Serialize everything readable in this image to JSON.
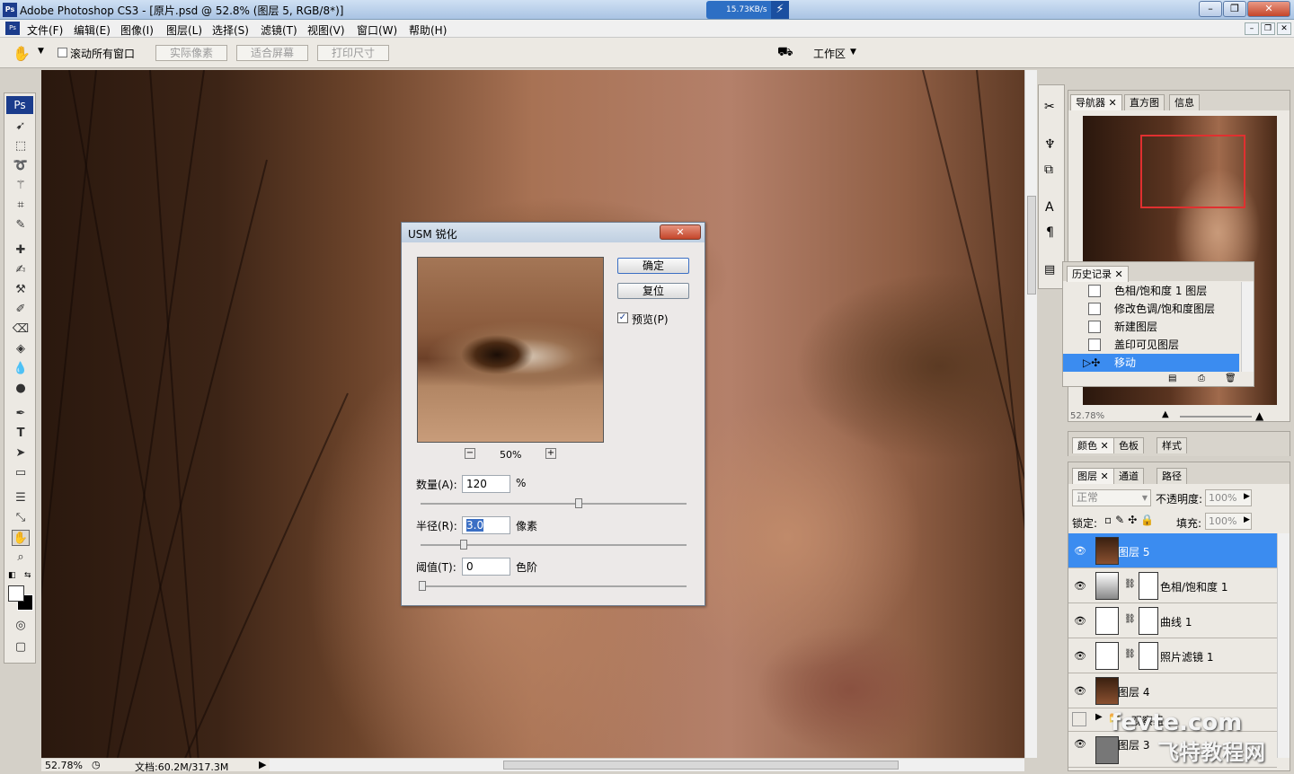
{
  "window": {
    "title": "Adobe Photoshop CS3 - [原片.psd @ 52.8% (图层 5, RGB/8*)]",
    "app_icon": "Ps"
  },
  "net_speed": {
    "value": "15.73KB/s"
  },
  "menu": [
    "文件(F)",
    "编辑(E)",
    "图像(I)",
    "图层(L)",
    "选择(S)",
    "滤镜(T)",
    "视图(V)",
    "窗口(W)",
    "帮助(H)"
  ],
  "options": {
    "scroll_all": "滚动所有窗口",
    "actual_pixels": "实际像素",
    "fit_screen": "适合屏幕",
    "print_size": "打印尺寸",
    "workspace": "工作区"
  },
  "status": {
    "zoom": "52.78%",
    "doc": "文档:60.2M/317.3M"
  },
  "dialog": {
    "title": "USM 锐化",
    "ok": "确定",
    "reset": "复位",
    "preview_label": "预览(P)",
    "preview_checked": true,
    "zoom": "50%",
    "amount_label": "数量(A):",
    "amount": "120",
    "amount_unit": "%",
    "radius_label": "半径(R):",
    "radius": "3.0",
    "radius_unit": "像素",
    "threshold_label": "阈值(T):",
    "threshold": "0",
    "threshold_unit": "色阶"
  },
  "navigator": {
    "tabs": [
      "导航器",
      "直方图",
      "信息"
    ],
    "zoom": "52.78%"
  },
  "history": {
    "tab": "历史记录",
    "items": [
      "色相/饱和度 1 图层",
      "修改色调/饱和度图层",
      "新建图层",
      "盖印可见图层",
      "移动"
    ]
  },
  "color_panel": {
    "tabs": [
      "颜色",
      "色板",
      "样式"
    ]
  },
  "layers": {
    "tabs": [
      "图层",
      "通道",
      "路径"
    ],
    "blend_mode": "正常",
    "opacity_label": "不透明度:",
    "opacity": "100%",
    "lock_label": "锁定:",
    "fill_label": "填充:",
    "fill": "100%",
    "items": [
      "图层 5",
      "色相/饱和度 1",
      "曲线 1",
      "照片滤镜 1",
      "图层 4",
      "观察组",
      "图层 3"
    ]
  },
  "watermark": {
    "text": "fevte.com",
    "brand": "飞特教程网"
  }
}
